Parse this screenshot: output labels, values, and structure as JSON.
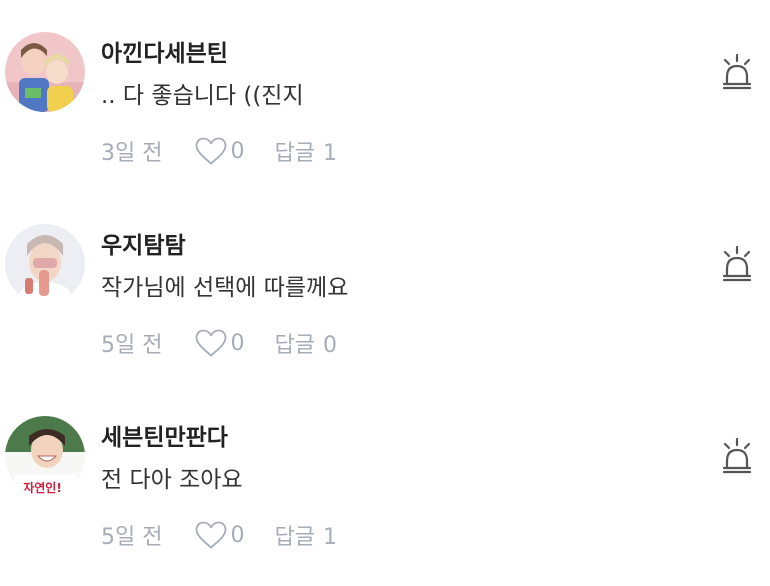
{
  "comments": [
    {
      "username": "아낀다세븐틴",
      "text": ".. 다 좋습니다 ((진지",
      "date": "3일 전",
      "likes": "0",
      "reply_label": "답글",
      "reply_count": "1"
    },
    {
      "username": "우지탐탐",
      "text": "작가님에 선택에 따를께요",
      "date": "5일 전",
      "likes": "0",
      "reply_label": "답글",
      "reply_count": "0"
    },
    {
      "username": "세븐틴만판다",
      "text": "전 다아 조아요",
      "date": "5일 전",
      "likes": "0",
      "reply_label": "답글",
      "reply_count": "1"
    }
  ],
  "avatar3_caption": "는 자연인!",
  "colors": {
    "username": "#222222",
    "text": "#333333",
    "meta": "#a6adb7",
    "icon": "#555555",
    "avatar3_caption": "#d81b3c"
  },
  "icons": {
    "like": "heart-outline-icon",
    "report": "siren-icon"
  }
}
